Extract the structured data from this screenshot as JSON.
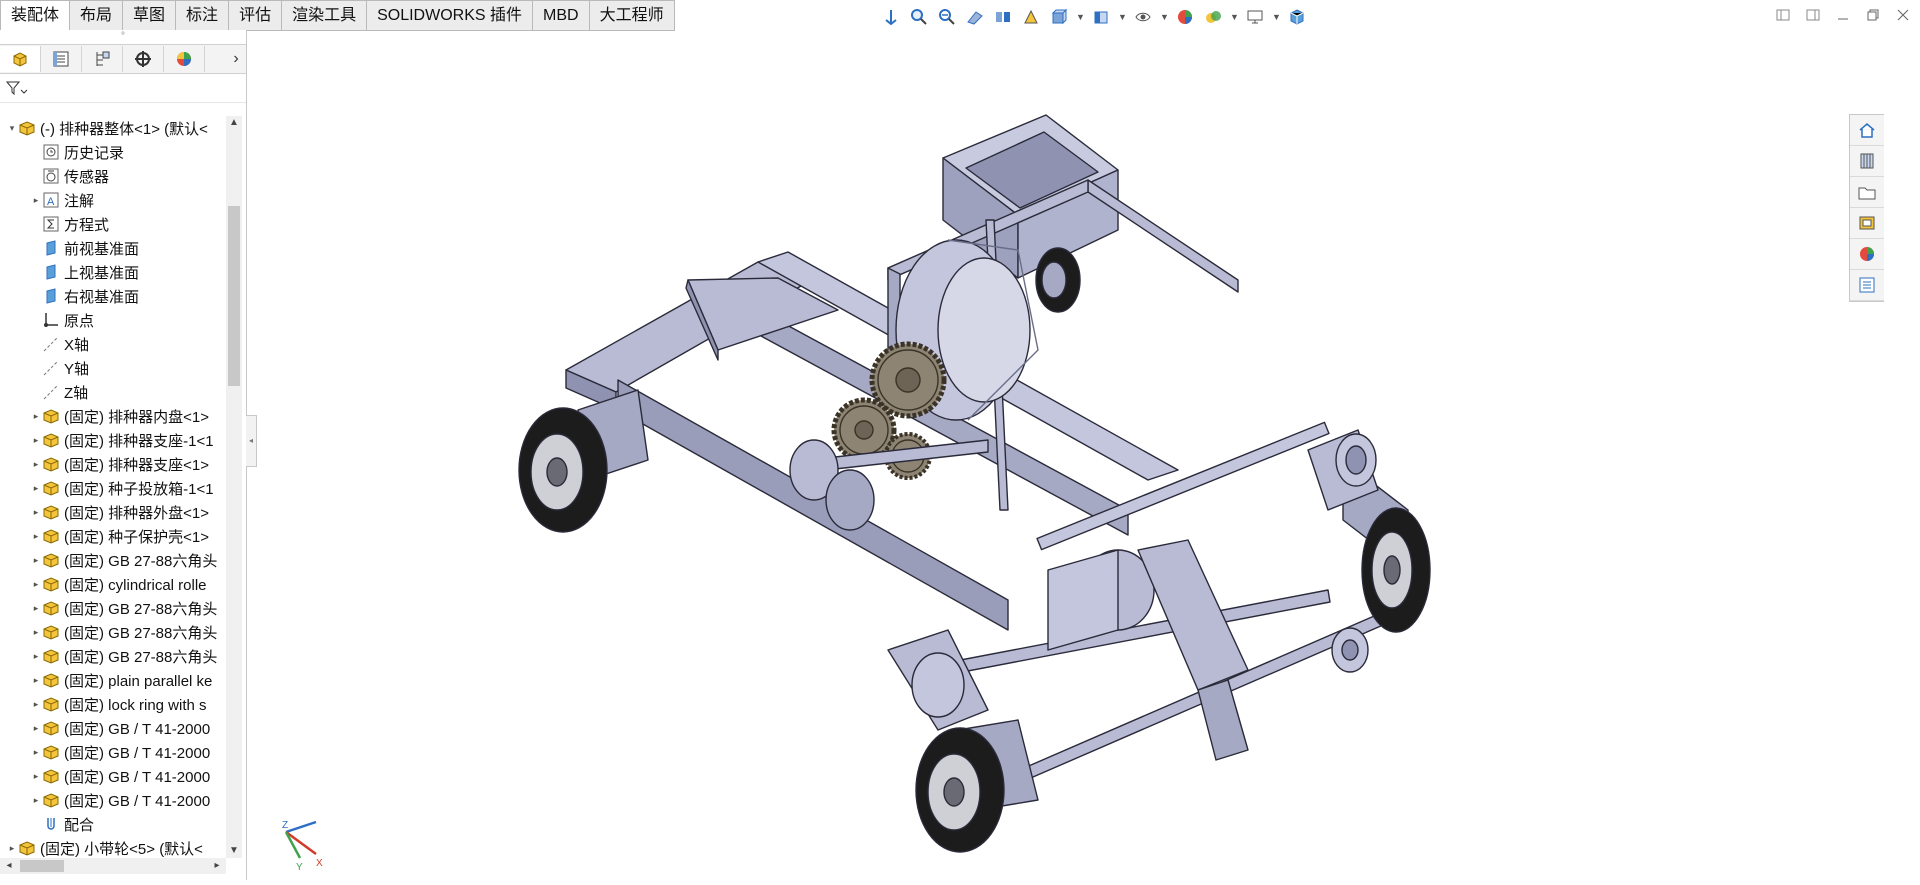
{
  "command_tabs": [
    "装配体",
    "布局",
    "草图",
    "标注",
    "评估",
    "渲染工具",
    "SOLIDWORKS 插件",
    "MBD",
    "大工程师"
  ],
  "feature_manager": {
    "tabs": [
      "feature-manager",
      "property-manager",
      "configuration-manager",
      "dimxpert-manager",
      "display-manager"
    ],
    "tree": [
      {
        "label": "(-) 排种器整体<1> (默认<",
        "icon": "assembly-icon",
        "indent": 0,
        "expand": "▾"
      },
      {
        "label": "历史记录",
        "icon": "history-icon",
        "indent": 1,
        "expand": ""
      },
      {
        "label": "传感器",
        "icon": "sensor-icon",
        "indent": 1,
        "expand": ""
      },
      {
        "label": "注解",
        "icon": "annotation-icon",
        "indent": 1,
        "expand": "▸"
      },
      {
        "label": "方程式",
        "icon": "equation-icon",
        "indent": 1,
        "expand": ""
      },
      {
        "label": "前视基准面",
        "icon": "plane-icon",
        "indent": 1,
        "expand": ""
      },
      {
        "label": "上视基准面",
        "icon": "plane-icon",
        "indent": 1,
        "expand": ""
      },
      {
        "label": "右视基准面",
        "icon": "plane-icon",
        "indent": 1,
        "expand": ""
      },
      {
        "label": "原点",
        "icon": "origin-icon",
        "indent": 1,
        "expand": ""
      },
      {
        "label": "X轴",
        "icon": "axis-icon",
        "indent": 1,
        "expand": ""
      },
      {
        "label": "Y轴",
        "icon": "axis-icon",
        "indent": 1,
        "expand": ""
      },
      {
        "label": "Z轴",
        "icon": "axis-icon",
        "indent": 1,
        "expand": ""
      },
      {
        "label": "(固定) 排种器内盘<1>",
        "icon": "part-icon",
        "indent": 1,
        "expand": "▸"
      },
      {
        "label": "(固定) 排种器支座-1<1",
        "icon": "part-icon",
        "indent": 1,
        "expand": "▸"
      },
      {
        "label": "(固定) 排种器支座<1>",
        "icon": "part-icon",
        "indent": 1,
        "expand": "▸"
      },
      {
        "label": "(固定) 种子投放箱-1<1",
        "icon": "part-icon",
        "indent": 1,
        "expand": "▸"
      },
      {
        "label": "(固定) 排种器外盘<1>",
        "icon": "part-icon",
        "indent": 1,
        "expand": "▸"
      },
      {
        "label": "(固定) 种子保护壳<1>",
        "icon": "part-icon",
        "indent": 1,
        "expand": "▸"
      },
      {
        "label": "(固定) GB 27-88六角头",
        "icon": "part-icon",
        "indent": 1,
        "expand": "▸"
      },
      {
        "label": "(固定) cylindrical rolle",
        "icon": "part-icon",
        "indent": 1,
        "expand": "▸"
      },
      {
        "label": "(固定) GB 27-88六角头",
        "icon": "part-icon",
        "indent": 1,
        "expand": "▸"
      },
      {
        "label": "(固定) GB 27-88六角头",
        "icon": "part-icon",
        "indent": 1,
        "expand": "▸"
      },
      {
        "label": "(固定) GB 27-88六角头",
        "icon": "part-icon",
        "indent": 1,
        "expand": "▸"
      },
      {
        "label": "(固定) plain parallel ke",
        "icon": "part-icon",
        "indent": 1,
        "expand": "▸"
      },
      {
        "label": "(固定) lock ring with s",
        "icon": "part-icon",
        "indent": 1,
        "expand": "▸"
      },
      {
        "label": "(固定) GB / T 41-2000",
        "icon": "part-icon",
        "indent": 1,
        "expand": "▸"
      },
      {
        "label": "(固定) GB / T 41-2000",
        "icon": "part-icon",
        "indent": 1,
        "expand": "▸"
      },
      {
        "label": "(固定) GB / T 41-2000",
        "icon": "part-icon",
        "indent": 1,
        "expand": "▸"
      },
      {
        "label": "(固定) GB / T 41-2000",
        "icon": "part-icon",
        "indent": 1,
        "expand": "▸"
      },
      {
        "label": "配合",
        "icon": "mates-icon",
        "indent": 1,
        "expand": ""
      },
      {
        "label": "(固定) 小带轮<5> (默认<",
        "icon": "part-icon",
        "indent": 0,
        "expand": "▸"
      }
    ]
  },
  "triad": {
    "x_label": "X",
    "y_label": "Y",
    "z_label": "Z"
  },
  "colors": {
    "part": "#b8bbd3",
    "part_dark": "#8f93b1",
    "part_line": "#2a2a3a",
    "tire": "#1c1c1c",
    "gear": "#8d8474",
    "accent_blue": "#2d6fc2"
  }
}
